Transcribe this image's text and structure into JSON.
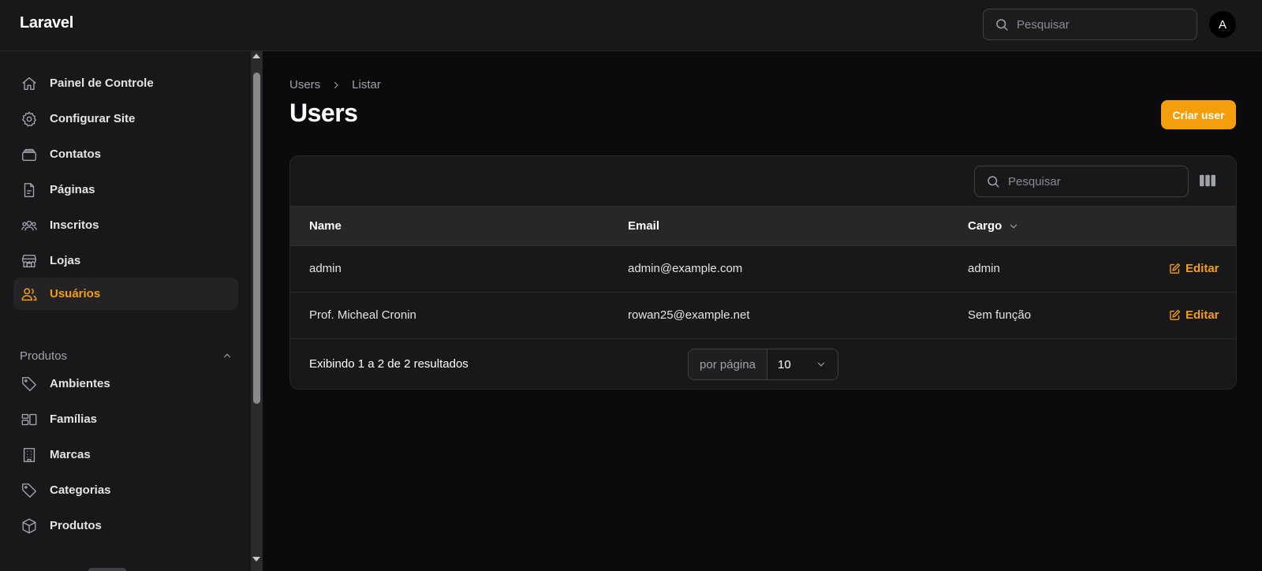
{
  "app": {
    "brand": "Laravel",
    "avatar_initial": "A",
    "accent_color": "#f59e0b"
  },
  "topbar": {
    "search_placeholder": "Pesquisar"
  },
  "sidebar": {
    "items": [
      {
        "label": "Painel de Controle",
        "icon": "home-icon"
      },
      {
        "label": "Configurar Site",
        "icon": "gear-icon"
      },
      {
        "label": "Contatos",
        "icon": "inbox-stack-icon"
      },
      {
        "label": "Páginas",
        "icon": "document-icon"
      },
      {
        "label": "Inscritos",
        "icon": "users-group-icon"
      },
      {
        "label": "Lojas",
        "icon": "storefront-icon"
      },
      {
        "label": "Usuários",
        "icon": "users-icon",
        "active": true
      }
    ],
    "group": {
      "label": "Produtos",
      "items": [
        {
          "label": "Ambientes",
          "icon": "tag-icon"
        },
        {
          "label": "Famílias",
          "icon": "squares-icon"
        },
        {
          "label": "Marcas",
          "icon": "building-icon"
        },
        {
          "label": "Categorias",
          "icon": "tag-icon"
        },
        {
          "label": "Produtos",
          "icon": "cube-icon"
        }
      ]
    }
  },
  "breadcrumb": {
    "items": [
      "Users",
      "Listar"
    ]
  },
  "page": {
    "title": "Users",
    "create_label": "Criar user"
  },
  "table": {
    "search_placeholder": "Pesquisar",
    "columns": [
      "Name",
      "Email",
      "Cargo"
    ],
    "rows": [
      {
        "name": "admin",
        "email": "admin@example.com",
        "cargo": "admin",
        "action": "Editar"
      },
      {
        "name": "Prof. Micheal Cronin",
        "email": "rowan25@example.net",
        "cargo": "Sem função",
        "action": "Editar"
      }
    ],
    "footer": {
      "summary": "Exibindo 1 a 2 de 2 resultados",
      "per_page_label": "por página",
      "per_page_value": "10"
    }
  }
}
